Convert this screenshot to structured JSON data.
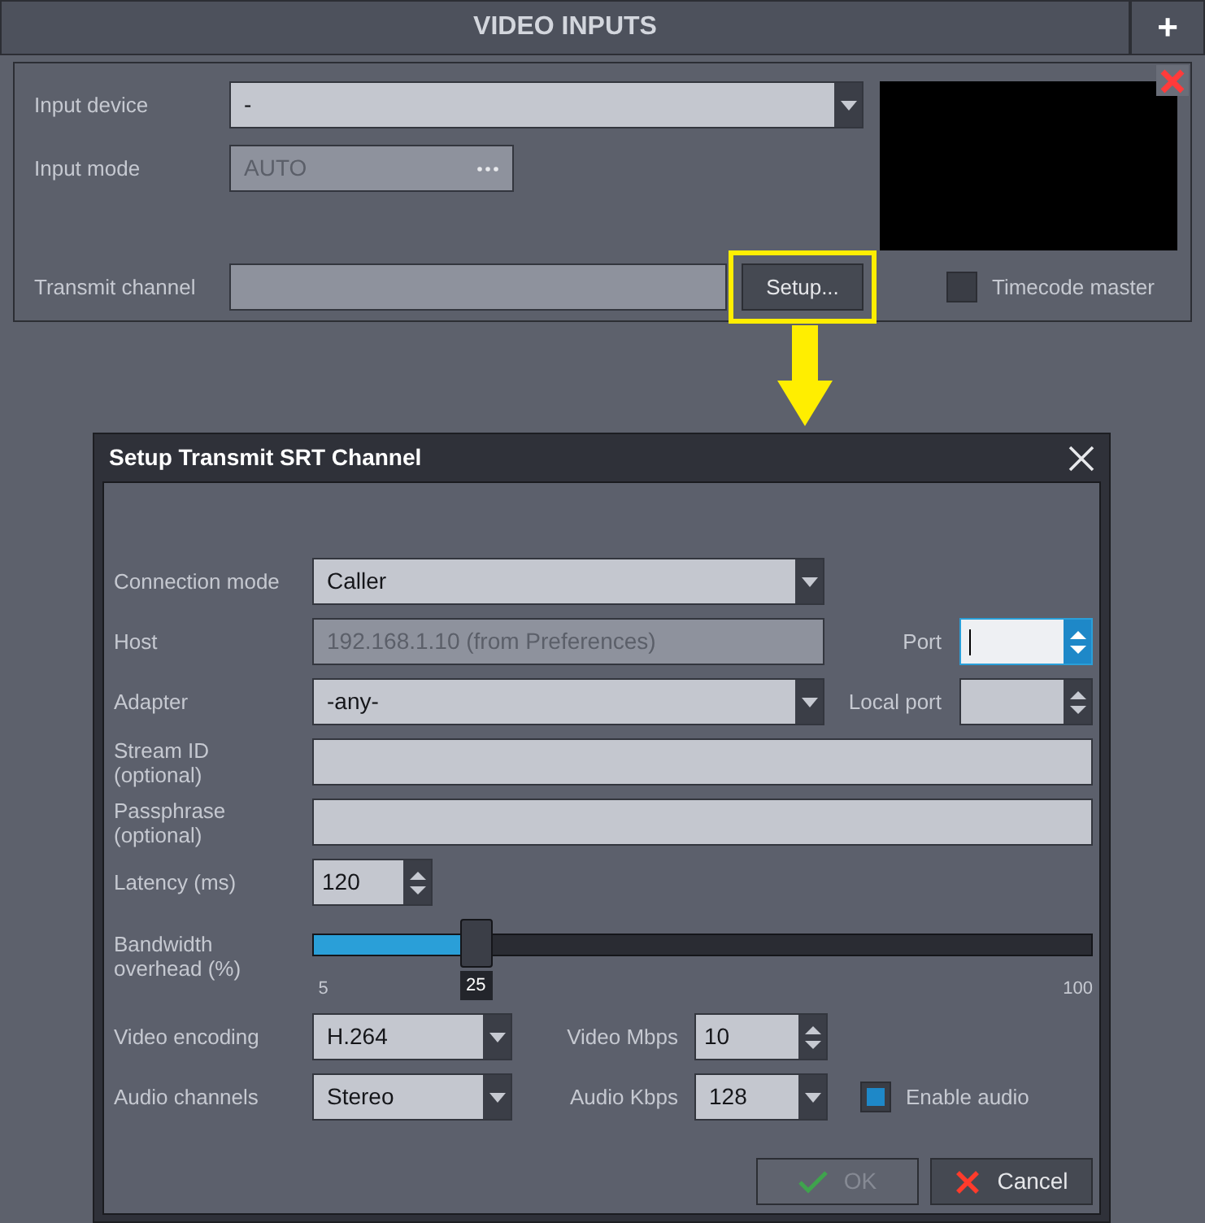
{
  "panel": {
    "title": "VIDEO INPUTS",
    "add_button": "+",
    "input_device": {
      "label": "Input device",
      "value": "-"
    },
    "input_mode": {
      "label": "Input mode",
      "value": "AUTO"
    },
    "transmit_channel": {
      "label": "Transmit channel",
      "button": "Setup...",
      "highlighted": true
    },
    "timecode_master": {
      "label": "Timecode master",
      "checked": false
    }
  },
  "dialog": {
    "title": "Setup Transmit SRT Channel",
    "rows": [
      {
        "label": "Connection mode",
        "control": {
          "kind": "dropdown",
          "value": "Caller"
        }
      },
      {
        "label": "Host",
        "control": {
          "kind": "text",
          "value": "192.168.1.10 (from Preferences)",
          "disabled": true
        },
        "side": {
          "label": "Port",
          "control": {
            "kind": "spinner",
            "focused": true
          }
        }
      },
      {
        "label": "Adapter",
        "control": {
          "kind": "dropdown",
          "value": "-any-"
        },
        "side": {
          "label": "Local port",
          "control": {
            "kind": "spinner",
            "focused": false
          }
        }
      },
      {
        "label": "Stream ID\n(optional)",
        "control": {
          "kind": "text",
          "disabled": false
        }
      },
      {
        "label": "Passphrase\n(optional)",
        "control": {
          "kind": "text",
          "disabled": false
        }
      }
    ],
    "latency": {
      "label": "Latency (ms)",
      "control": {
        "kind": "spinner",
        "value": "120",
        "focused": false
      }
    },
    "bandwidth": {
      "label": "Bandwidth\noverhead (%)",
      "level": 0.21,
      "min": "5",
      "value": "25",
      "max": "100"
    },
    "media_rows": [
      {
        "label": "Video encoding",
        "control": {
          "kind": "dropdown",
          "value": "H.264"
        },
        "side": {
          "label": "Video Mbps",
          "control": {
            "kind": "spinner",
            "value": "10",
            "focused": false
          }
        }
      },
      {
        "label": "Audio channels",
        "control": {
          "kind": "dropdown",
          "value": "Stereo"
        },
        "side": {
          "label": "Audio Kbps",
          "control": {
            "kind": "dropdown",
            "value": "128"
          }
        },
        "checkbox": {
          "label": "Enable audio",
          "checked": true
        }
      }
    ],
    "buttons": [
      {
        "label": "OK",
        "kind": "ok",
        "disabled": true
      },
      {
        "label": "Cancel",
        "kind": "cancel",
        "disabled": false
      }
    ]
  }
}
